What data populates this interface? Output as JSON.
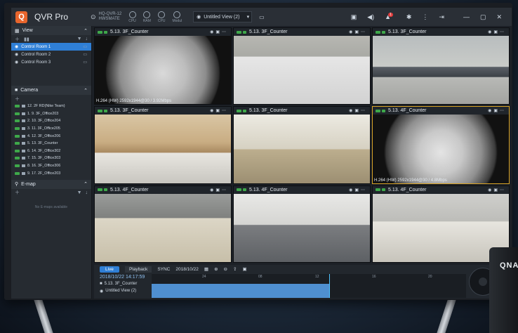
{
  "app": {
    "title": "QVR Pro",
    "logo_icon": "qvr-logo-icon"
  },
  "titlebar": {
    "host_line1": "HQ-QVR-12",
    "host_line2": "HWSMATE",
    "gauges": [
      "CPU",
      "RAM",
      "CPU",
      "Modul"
    ],
    "view_select": "Untitled View (2)",
    "notification_count": "1"
  },
  "left": {
    "view_header": "View",
    "views": [
      {
        "label": "Control Room 1",
        "selected": true
      },
      {
        "label": "Control Room 2",
        "selected": false
      },
      {
        "label": "Control Room 3",
        "selected": false
      }
    ],
    "camera_header": "Camera",
    "cameras": [
      "12. 2F RD(Nike Team)",
      "1. 9. 3F_Office203",
      "2. 10. 3F_Office204",
      "3. 11. 3F_Office205",
      "4. 12. 3F_Office206",
      "5. 13. 3F_Counter",
      "6. 14. 3F_Office302",
      "7. 15. 3F_Office303",
      "8. 16. 3F_Office306",
      "9. 17. 2F_Office203"
    ],
    "emap_header": "E-map",
    "emap_empty": "No E-maps available"
  },
  "tiles": [
    {
      "label": "5.13. 3F_Counter",
      "info": "H.264 (HW) 2592x1944@30 / 3.92Mbps",
      "scene": "fisheye",
      "highlight": false
    },
    {
      "label": "5.13. 3F_Counter",
      "info": "",
      "scene": "lobby",
      "highlight": false
    },
    {
      "label": "5.13. 3F_Counter",
      "info": "",
      "scene": "sofa",
      "highlight": false
    },
    {
      "label": "5.13. 3F_Counter",
      "info": "",
      "scene": "office",
      "highlight": false
    },
    {
      "label": "5.13. 3F_Counter",
      "info": "",
      "scene": "hall",
      "highlight": false
    },
    {
      "label": "5.13. 4F_Counter",
      "info": "H.264 (HW) 2592x1944@30 / 4.8Mbps",
      "scene": "fisheye2",
      "highlight": true
    },
    {
      "label": "5.13. 4F_Counter",
      "info": "",
      "scene": "tables",
      "highlight": false
    },
    {
      "label": "5.13. 4F_Counter",
      "info": "",
      "scene": "corridor",
      "highlight": false
    },
    {
      "label": "5.13. 4F_Counter",
      "info": "",
      "scene": "room",
      "highlight": false
    }
  ],
  "timeline": {
    "live_label": "Live",
    "playback_label": "Playback",
    "sync_label": "SYNC",
    "date": "2018/10/22",
    "timestamp": "2018/10/22 14:17:59",
    "rows": [
      "5.13. 3F_Counter",
      "Untitled View (2)"
    ],
    "ticks": [
      "24",
      "08",
      "12",
      "16",
      "20"
    ],
    "cursor_fraction": 0.565
  },
  "device": {
    "brand": "QNAP"
  }
}
